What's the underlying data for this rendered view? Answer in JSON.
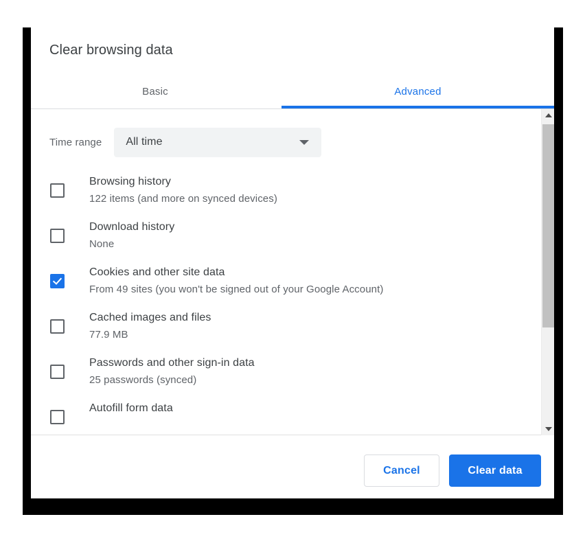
{
  "dialog": {
    "title": "Clear browsing data",
    "tabs": [
      {
        "label": "Basic",
        "selected": false
      },
      {
        "label": "Advanced",
        "selected": true
      }
    ],
    "time_range": {
      "label": "Time range",
      "value": "All time",
      "chevron_icon": "chevron-down-icon"
    },
    "options": [
      {
        "title": "Browsing history",
        "subtitle": "122 items (and more on synced devices)",
        "checked": false
      },
      {
        "title": "Download history",
        "subtitle": "None",
        "checked": false
      },
      {
        "title": "Cookies and other site data",
        "subtitle": "From 49 sites (you won't be signed out of your Google Account)",
        "checked": true
      },
      {
        "title": "Cached images and files",
        "subtitle": "77.9 MB",
        "checked": false
      },
      {
        "title": "Passwords and other sign-in data",
        "subtitle": "25 passwords (synced)",
        "checked": false
      },
      {
        "title": "Autofill form data",
        "subtitle": "",
        "checked": false
      }
    ],
    "scrollbar": {
      "up_arrow_icon": "scroll-up-arrow-icon",
      "down_arrow_icon": "scroll-down-arrow-icon"
    },
    "footer": {
      "cancel_label": "Cancel",
      "confirm_label": "Clear data"
    }
  },
  "colors": {
    "accent": "#1a73e8",
    "text_primary": "#3c4043",
    "text_secondary": "#5f6368",
    "select_background": "#f1f3f4",
    "divider": "#dadce0",
    "scrollbar_track": "#f1f1f1",
    "scrollbar_thumb": "#c1c1c1",
    "frame": "#000000"
  }
}
